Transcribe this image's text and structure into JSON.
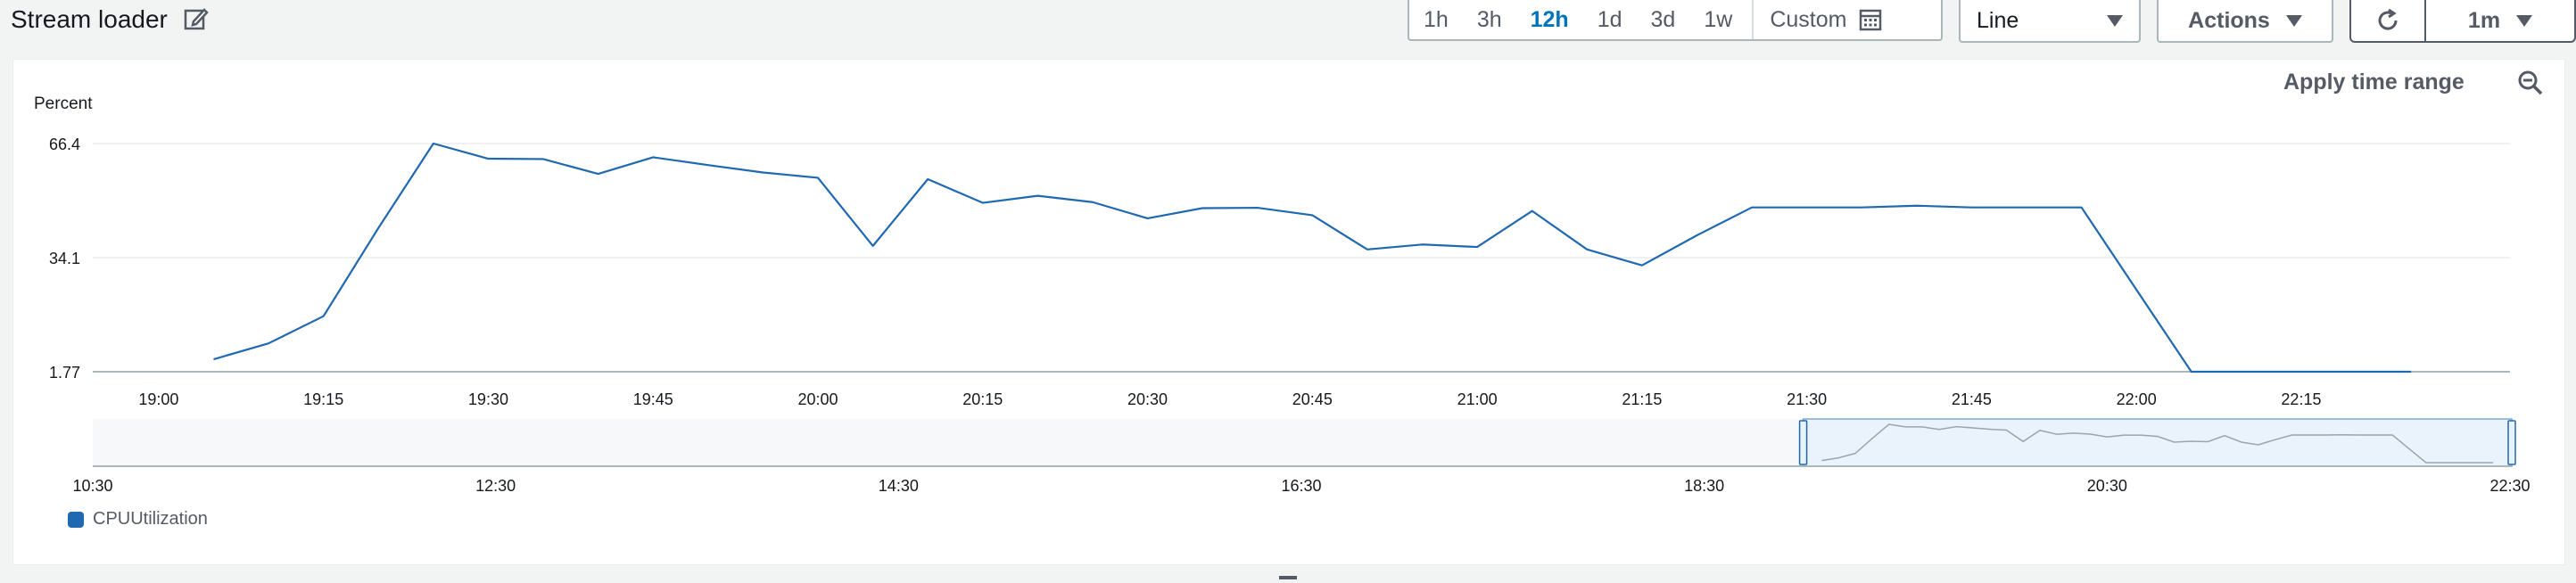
{
  "header": {
    "title": "Stream loader",
    "time_ranges": [
      "1h",
      "3h",
      "12h",
      "1d",
      "3d",
      "1w"
    ],
    "active_range": "12h",
    "custom_label": "Custom",
    "chart_type_label": "Line",
    "actions_label": "Actions",
    "refresh_interval": "1m"
  },
  "panel": {
    "apply_range_label": "Apply time range"
  },
  "legend": {
    "label": "CPUUtilization",
    "color": "#1f69b1"
  },
  "chart_data": {
    "type": "line",
    "ylabel": "Percent",
    "yticks": [
      "66.4",
      "34.1",
      "1.77"
    ],
    "ylim": [
      1.77,
      66.4
    ],
    "xticks": [
      "19:00",
      "19:15",
      "19:30",
      "19:45",
      "20:00",
      "20:15",
      "20:30",
      "20:45",
      "21:00",
      "21:15",
      "21:30",
      "21:45",
      "22:00",
      "22:15"
    ],
    "x": [
      "19:05",
      "19:10",
      "19:15",
      "19:20",
      "19:25",
      "19:30",
      "19:35",
      "19:40",
      "19:45",
      "19:50",
      "19:55",
      "20:00",
      "20:05",
      "20:10",
      "20:15",
      "20:20",
      "20:25",
      "20:30",
      "20:35",
      "20:40",
      "20:45",
      "20:50",
      "20:55",
      "21:00",
      "21:05",
      "21:10",
      "21:15",
      "21:20",
      "21:25",
      "21:30",
      "21:35",
      "21:40",
      "21:45",
      "21:50",
      "21:55",
      "22:00",
      "22:05",
      "22:10",
      "22:15",
      "22:20",
      "22:25"
    ],
    "series": [
      {
        "name": "CPUUtilization",
        "color": "#1f69b1",
        "values": [
          5.3,
          9.8,
          17.5,
          42.5,
          66.4,
          62.1,
          62.0,
          57.8,
          62.5,
          60.3,
          58.2,
          56.7,
          37.4,
          56.3,
          49.6,
          51.6,
          49.8,
          45.2,
          48.1,
          48.2,
          46.1,
          36.4,
          37.8,
          37.1,
          47.3,
          36.4,
          31.9,
          40.4,
          48.3,
          48.3,
          48.3,
          48.8,
          48.3,
          48.3,
          48.3,
          25.0,
          1.77,
          1.77,
          1.77,
          1.77,
          1.77
        ]
      }
    ],
    "grid": true,
    "navigator": {
      "xticks": [
        "10:30",
        "12:30",
        "14:30",
        "16:30",
        "18:30",
        "20:30",
        "22:30"
      ],
      "selected_range": [
        "19:00",
        "22:30"
      ]
    }
  }
}
